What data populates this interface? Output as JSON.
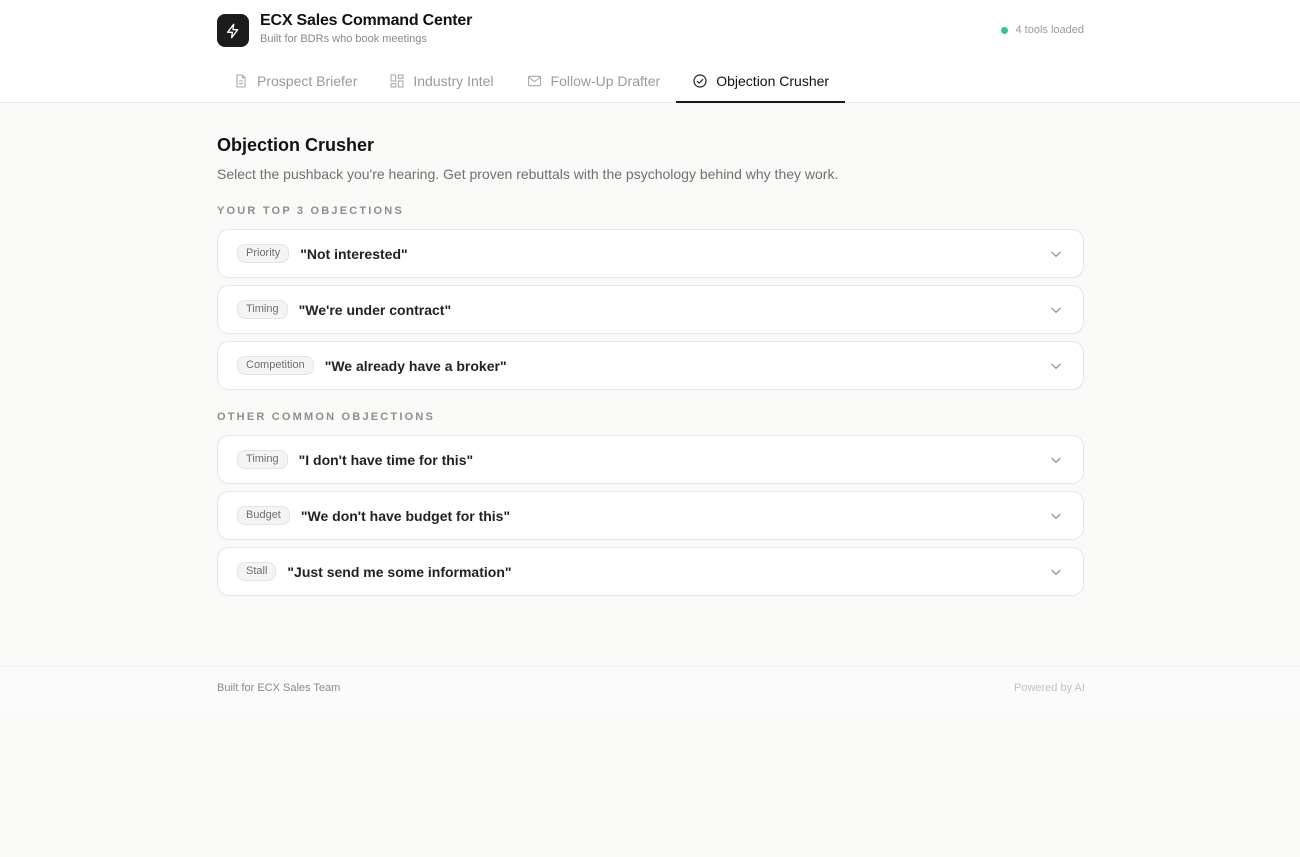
{
  "app": {
    "title": "ECX Sales Command Center",
    "subtitle": "Built for BDRs who book meetings",
    "status_text": "4 tools loaded",
    "status_color": "#34c48b",
    "logo_icon": "lightning-bolt-icon"
  },
  "tabs": [
    {
      "label": "Prospect Briefer",
      "icon": "document-icon",
      "active": false
    },
    {
      "label": "Industry Intel",
      "icon": "grid-icon",
      "active": false
    },
    {
      "label": "Follow-Up Drafter",
      "icon": "mail-icon",
      "active": false
    },
    {
      "label": "Objection Crusher",
      "icon": "check-circle-icon",
      "active": true
    }
  ],
  "page": {
    "title": "Objection Crusher",
    "description": "Select the pushback you're hearing. Get proven rebuttals with the psychology behind why they work."
  },
  "sections": {
    "top": {
      "label": "YOUR TOP 3 OBJECTIONS",
      "items": [
        {
          "tag": "Priority",
          "text": "\"Not interested\""
        },
        {
          "tag": "Timing",
          "text": "\"We're under contract\""
        },
        {
          "tag": "Competition",
          "text": "\"We already have a broker\""
        }
      ]
    },
    "other": {
      "label": "OTHER COMMON OBJECTIONS",
      "items": [
        {
          "tag": "Timing",
          "text": "\"I don't have time for this\""
        },
        {
          "tag": "Budget",
          "text": "\"We don't have budget for this\""
        },
        {
          "tag": "Stall",
          "text": "\"Just send me some information\""
        }
      ]
    }
  },
  "footer": {
    "left": "Built for ECX Sales Team",
    "right": "Powered by AI"
  }
}
